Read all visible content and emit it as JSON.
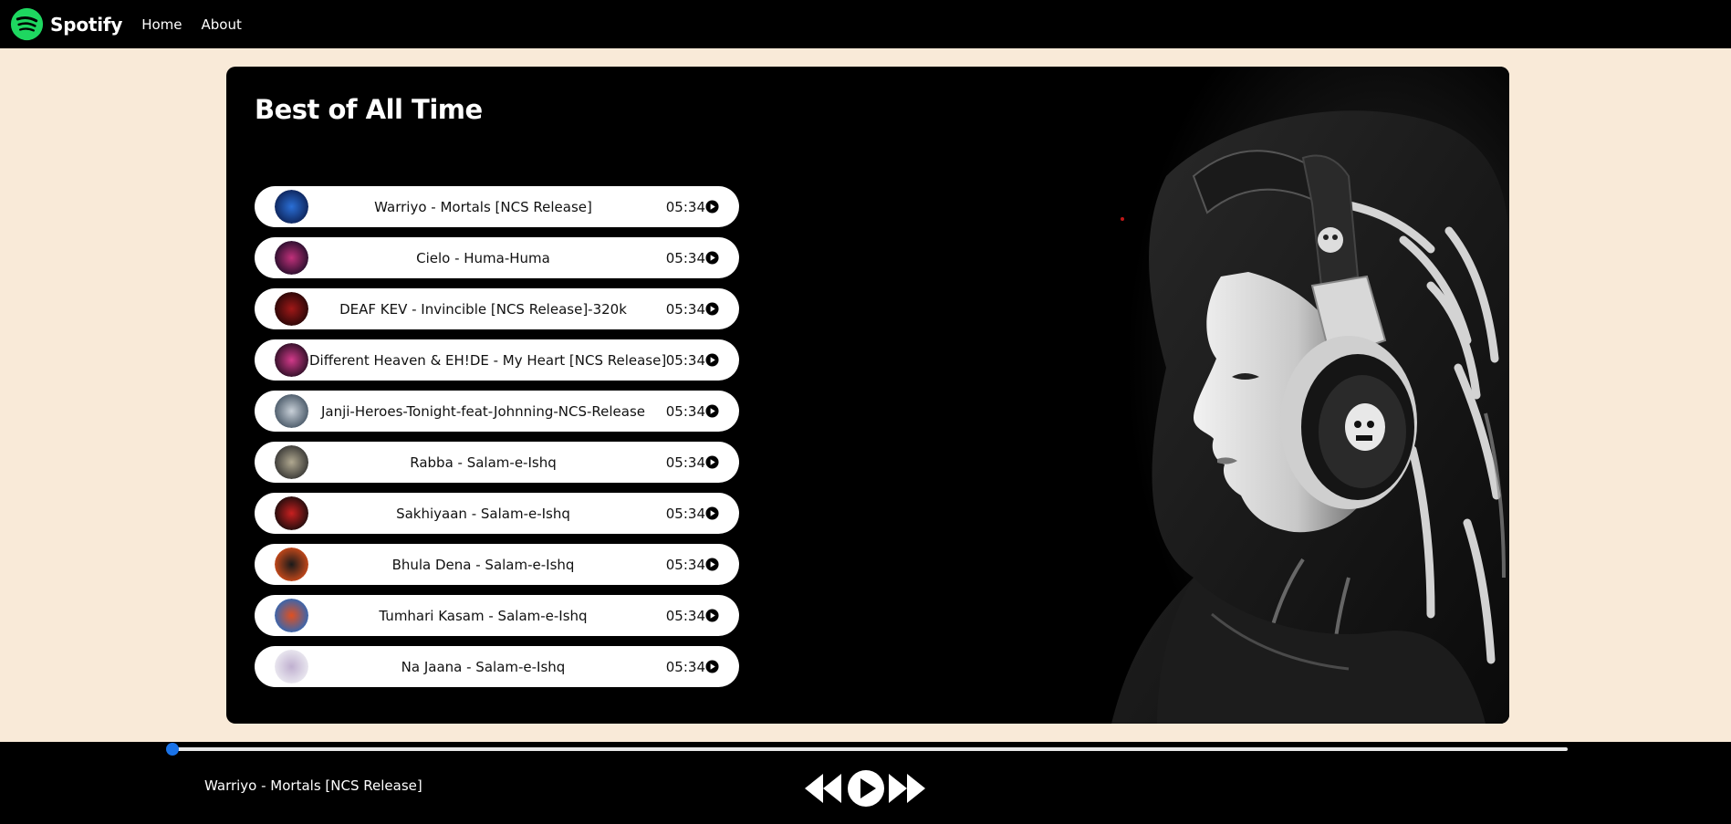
{
  "nav": {
    "brand": "Spotify",
    "links": [
      "Home",
      "About"
    ]
  },
  "playlist": {
    "title": "Best of All Time",
    "songs": [
      {
        "name": "Warriyo - Mortals [NCS Release]",
        "duration": "05:34",
        "cover_colors": [
          "#0a1a4a",
          "#2a6fd6"
        ]
      },
      {
        "name": "Cielo - Huma-Huma",
        "duration": "05:34",
        "cover_colors": [
          "#140a22",
          "#c0307a"
        ]
      },
      {
        "name": "DEAF KEV - Invincible [NCS Release]-320k",
        "duration": "05:34",
        "cover_colors": [
          "#1a0505",
          "#a01818"
        ]
      },
      {
        "name": "Different Heaven & EH!DE - My Heart [NCS Release]",
        "duration": "05:34",
        "cover_colors": [
          "#1a0a1a",
          "#d23a8a"
        ]
      },
      {
        "name": "Janji-Heroes-Tonight-feat-Johnning-NCS-Release",
        "duration": "05:34",
        "cover_colors": [
          "#3a4a5a",
          "#c8d0d8"
        ]
      },
      {
        "name": "Rabba - Salam-e-Ishq",
        "duration": "05:34",
        "cover_colors": [
          "#2a2a2a",
          "#b0a890"
        ]
      },
      {
        "name": "Sakhiyaan - Salam-e-Ishq",
        "duration": "05:34",
        "cover_colors": [
          "#0a0a0a",
          "#c82020"
        ]
      },
      {
        "name": "Bhula Dena - Salam-e-Ishq",
        "duration": "05:34",
        "cover_colors": [
          "#e0501a",
          "#1a1a1a"
        ]
      },
      {
        "name": "Tumhari Kasam - Salam-e-Ishq",
        "duration": "05:34",
        "cover_colors": [
          "#1a6ac8",
          "#e05020"
        ]
      },
      {
        "name": "Na Jaana - Salam-e-Ishq",
        "duration": "05:34",
        "cover_colors": [
          "#f0f0f4",
          "#c0b0d0"
        ]
      }
    ]
  },
  "player": {
    "now_playing": "Warriyo - Mortals [NCS Release]",
    "progress": 0,
    "icons": [
      "previous-icon",
      "play-icon",
      "next-icon"
    ]
  },
  "colors": {
    "brand_green": "#1ed760",
    "background": "#f9ead8",
    "seek_thumb": "#1a73e8"
  }
}
